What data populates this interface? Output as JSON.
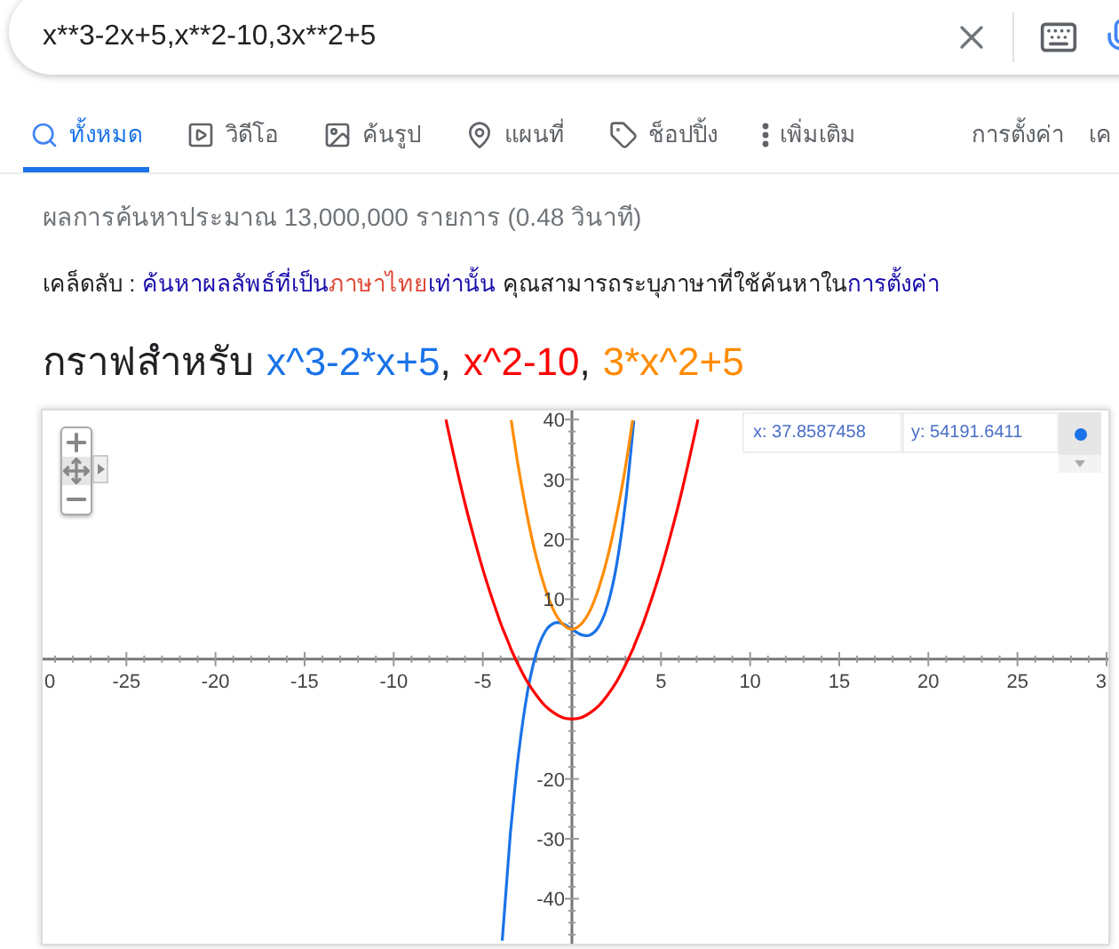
{
  "search": {
    "value": "x**3-2x+5,x**2-10,3x**2+5"
  },
  "tabs": [
    {
      "label": "ทั้งหมด",
      "kind": "search",
      "selected": true
    },
    {
      "label": "วิดีโอ",
      "kind": "video",
      "selected": false
    },
    {
      "label": "ค้นรูป",
      "kind": "image",
      "selected": false
    },
    {
      "label": "แผนที่",
      "kind": "map",
      "selected": false
    },
    {
      "label": "ช็อปปิ้ง",
      "kind": "tag",
      "selected": false
    },
    {
      "label": "เพิ่มเติม",
      "kind": "more",
      "selected": false
    }
  ],
  "tools": [
    "การตั้งค่า",
    "เค"
  ],
  "result_stats": "ผลการค้นหาประมาณ 13,000,000 รายการ (0.48 วินาที)",
  "tip": {
    "label": "เคล็ดลับ :",
    "parts": [
      {
        "kind": "link",
        "text": "ค้นหาผลลัพธ์ที่เป็น"
      },
      {
        "kind": "highlight",
        "text": "ภาษาไทย"
      },
      {
        "kind": "link",
        "text": "เท่านั้น"
      },
      {
        "kind": "plain",
        "text": "คุณสามารถระบุภาษาที่ใช้ค้นหาใน"
      },
      {
        "kind": "link",
        "text": "การตั้งค่า"
      }
    ]
  },
  "chart": {
    "title_prefix": "กราฟสำหรับ",
    "separators": [
      ",",
      ","
    ],
    "readout": {
      "x": "x: 37.8587458",
      "y": "y: 54191.6411"
    },
    "cut_tick_labels": [
      "0",
      "3"
    ],
    "chart_data": {
      "type": "line",
      "x": [
        -7.07,
        -7,
        -6.5,
        -6,
        -5.5,
        -5,
        -4.5,
        -4,
        -3.91,
        -3.5,
        -3.41,
        -3,
        -2.5,
        -2,
        -1.5,
        -1,
        -0.5,
        0,
        0.5,
        1,
        1.5,
        2,
        2.5,
        3,
        3.41,
        3.47,
        3.5,
        4,
        4.5,
        5,
        5.5,
        6,
        6.5,
        7,
        7.07
      ],
      "series": [
        {
          "name": "x^3-2*x+5",
          "color": "#1a73e8",
          "values": [
            null,
            null,
            null,
            null,
            null,
            null,
            null,
            null,
            -47,
            -30.9,
            -27.8,
            -16,
            -5.6,
            1,
            4.6,
            6,
            5.9,
            5,
            4.1,
            4,
            5.4,
            9,
            15.6,
            26,
            37.8,
            39.8,
            null,
            null,
            null,
            null,
            null,
            null,
            null,
            null,
            null
          ]
        },
        {
          "name": "x^2-10",
          "color": "#ff0000",
          "values": [
            40,
            39,
            32.3,
            26,
            20.3,
            15,
            10.3,
            6,
            5.3,
            2.3,
            1.6,
            -1,
            -3.8,
            -6,
            -7.8,
            -9,
            -9.8,
            -10,
            -9.8,
            -9,
            -7.8,
            -6,
            -3.8,
            -1,
            1.6,
            2,
            2.3,
            6,
            10.3,
            15,
            20.3,
            26,
            32.3,
            39,
            40
          ]
        },
        {
          "name": "3*x^2+5",
          "color": "#ff8c00",
          "values": [
            null,
            null,
            null,
            null,
            null,
            null,
            null,
            null,
            null,
            null,
            39.9,
            32,
            23.8,
            17,
            11.8,
            8,
            5.8,
            5,
            5.8,
            8,
            11.8,
            17,
            23.8,
            32,
            39.9,
            null,
            null,
            null,
            null,
            null,
            null,
            null,
            null,
            null,
            null
          ]
        }
      ],
      "xlim": [
        -29.7,
        30.1
      ],
      "ylim": [
        -47.5,
        41.5
      ],
      "xticks": [
        -25,
        -20,
        -15,
        -10,
        -5,
        5,
        10,
        15,
        20,
        25
      ],
      "yticks": [
        40,
        30,
        20,
        10,
        -20,
        -30,
        -40
      ]
    }
  }
}
